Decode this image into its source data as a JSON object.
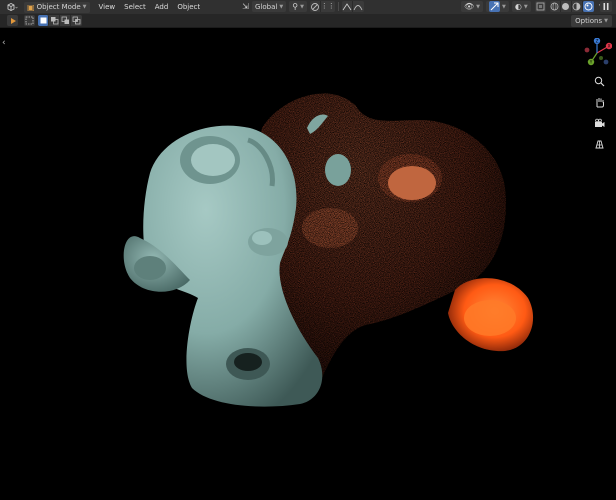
{
  "header": {
    "mode": {
      "label": "Object Mode"
    },
    "menus": [
      "View",
      "Select",
      "Add",
      "Object"
    ],
    "transform_orientation": {
      "label": "Global"
    },
    "options_label": "Options"
  },
  "icons": {
    "editor_type": "cube-icon",
    "select_box": "select-box-icon",
    "select_modes": [
      "select-new-icon",
      "select-extend-icon",
      "select-subtract-icon",
      "select-intersect-icon"
    ],
    "pivot": "pivot-icon",
    "snap": "magnet-icon",
    "proportional": "proportional-icon",
    "visibility": "eye-icon",
    "gizmo": "gizmo-icon",
    "overlays": "overlay-icon",
    "xray": "xray-icon",
    "shading_modes": [
      "wireframe-icon",
      "solid-icon",
      "material-icon",
      "rendered-icon"
    ],
    "pause": "pause-icon",
    "play": "play-icon"
  },
  "navigation": {
    "gizmo_axes": [
      "X",
      "Y",
      "Z"
    ],
    "tools": [
      "zoom-icon",
      "pan-hand-icon",
      "camera-icon",
      "grid-view-icon"
    ]
  },
  "colors": {
    "accent": "#4772b3",
    "axis_x": "#e0364a",
    "axis_y": "#6ba32b",
    "axis_z": "#3a7bd6",
    "teal_material": "#8fb5b1",
    "orange_material": "#b4482a",
    "glow": "#ff6a1a"
  }
}
